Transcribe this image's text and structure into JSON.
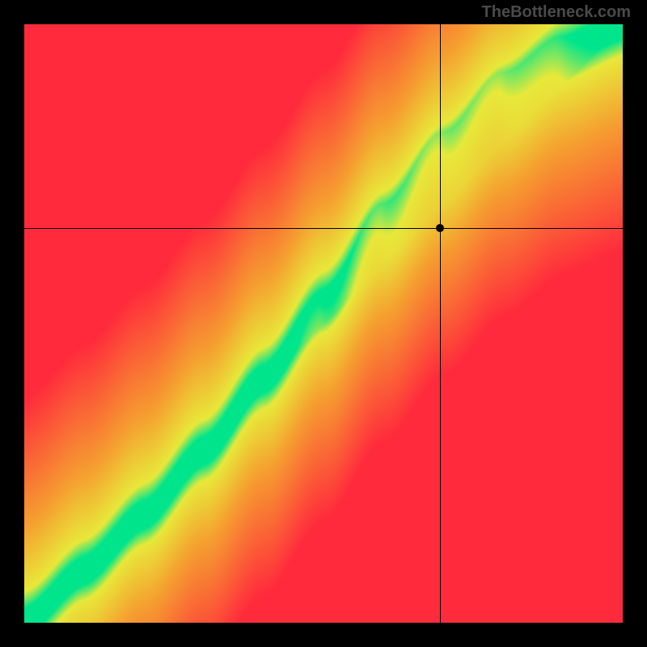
{
  "watermark": "TheBottleneck.com",
  "chart_data": {
    "type": "heatmap",
    "title": "",
    "xlabel": "",
    "ylabel": "",
    "xlim": [
      0,
      1
    ],
    "ylim": [
      0,
      1
    ],
    "crosshair": {
      "x": 0.695,
      "y": 0.66
    },
    "marker": {
      "x": 0.695,
      "y": 0.66
    },
    "ridge_curve_description": "Green optimal band runs diagonally from bottom-left to upper-right, curving slightly; surrounded by yellow transition, fading to orange then red at far corners.",
    "color_stops": {
      "optimal": "#00E58C",
      "near": "#E8E83A",
      "mid": "#F5A030",
      "far": "#FF2A3C"
    },
    "ridge_samples": [
      {
        "x": 0.0,
        "y": 0.0
      },
      {
        "x": 0.1,
        "y": 0.08
      },
      {
        "x": 0.2,
        "y": 0.17
      },
      {
        "x": 0.3,
        "y": 0.28
      },
      {
        "x": 0.4,
        "y": 0.41
      },
      {
        "x": 0.5,
        "y": 0.55
      },
      {
        "x": 0.6,
        "y": 0.7
      },
      {
        "x": 0.7,
        "y": 0.82
      },
      {
        "x": 0.8,
        "y": 0.92
      },
      {
        "x": 0.9,
        "y": 0.98
      },
      {
        "x": 1.0,
        "y": 1.0
      }
    ]
  }
}
